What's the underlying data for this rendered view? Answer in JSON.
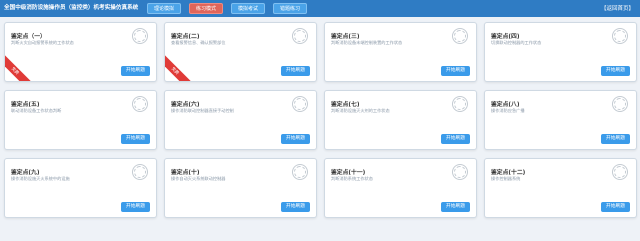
{
  "header": {
    "title": "全国中级消防设施操作员（监控类）机考实操仿真系统",
    "buttons": [
      {
        "label": "理论模拟",
        "active": false
      },
      {
        "label": "练习模式",
        "active": true
      },
      {
        "label": "模拟考试",
        "active": false
      },
      {
        "label": "错题练习",
        "active": false
      }
    ],
    "return_label": "【返回首页】"
  },
  "colors": {
    "header_bg": "#2f7cc4",
    "active_button": "#e0655a",
    "start_button": "#3a9bea",
    "ribbon": "#e03b38"
  },
  "cards": [
    {
      "title": "鉴定点（一）",
      "desc": "判断火灾自动报警系统的工作状态",
      "button": "开始刷题",
      "ribbon": "免费"
    },
    {
      "title": "鉴定点(二)",
      "desc": "查看报警信息、确认报警部位",
      "button": "开始刷题",
      "ribbon": "免费"
    },
    {
      "title": "鉴定点(三)",
      "desc": "判断消防设备末端控制装置的工作状态",
      "button": "开始刷题"
    },
    {
      "title": "鉴定点(四)",
      "desc": "切换联动控制器的工作状态",
      "button": "开始刷题"
    },
    {
      "title": "鉴定点(五)",
      "desc": "联动消防设备工作状态判断",
      "button": "开始刷题"
    },
    {
      "title": "鉴定点(六)",
      "desc": "操作消防联动控制器直接手动控制",
      "button": "开始刷题"
    },
    {
      "title": "鉴定点(七)",
      "desc": "判断消防设施灭火剂的工作状态",
      "button": "开始刷题"
    },
    {
      "title": "鉴定点(八)",
      "desc": "操作消防应急广播",
      "button": "开始刷题"
    },
    {
      "title": "鉴定点(九)",
      "desc": "操作消防设施灭火系统中的设施",
      "button": "开始刷题"
    },
    {
      "title": "鉴定点(十)",
      "desc": "操作自动灭火系统联动控制器",
      "button": "开始刷题"
    },
    {
      "title": "鉴定点(十一)",
      "desc": "判断消防系统工作状态",
      "button": "开始刷题"
    },
    {
      "title": "鉴定点(十二)",
      "desc": "操作控制器系统",
      "button": "开始刷题"
    }
  ]
}
